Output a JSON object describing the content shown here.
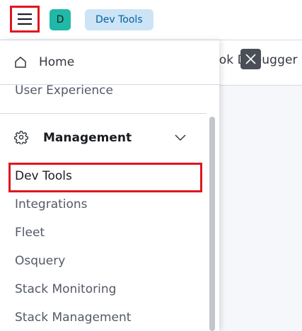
{
  "header": {
    "menu_icon": "hamburger-menu-icon",
    "space_avatar_initial": "D",
    "breadcrumb": "Dev Tools",
    "colors": {
      "highlight": "#e0161f",
      "avatar_bg": "#20b8a6",
      "breadcrumb_bg": "#cce4f5",
      "breadcrumb_text": "#0061a6"
    }
  },
  "background_page": {
    "tab_label": "rok Debugger",
    "close_icon": "close-x-icon"
  },
  "nav": {
    "home": {
      "icon": "home-icon",
      "label": "Home"
    },
    "user_experience": "User Experience",
    "management": {
      "icon": "gear-icon",
      "label": "Management",
      "expand_icon": "chevron-down-icon",
      "items": [
        {
          "label": "Dev Tools",
          "active": true
        },
        {
          "label": "Integrations"
        },
        {
          "label": "Fleet"
        },
        {
          "label": "Osquery"
        },
        {
          "label": "Stack Monitoring"
        },
        {
          "label": "Stack Management"
        }
      ]
    }
  }
}
